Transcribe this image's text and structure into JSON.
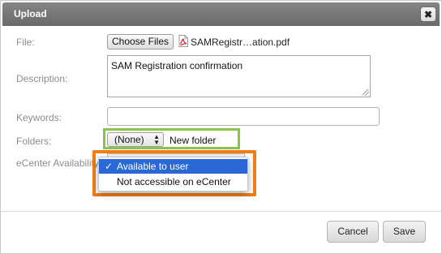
{
  "dialog": {
    "title": "Upload",
    "close_glyph": "✖"
  },
  "form": {
    "file_label": "File:",
    "choose_files_label": "Choose Files",
    "file_name": "SAMRegistr…ation.pdf",
    "description_label": "Description:",
    "description_value": "SAM Registration confirmation",
    "keywords_label": "Keywords:",
    "keywords_value": "",
    "folders_label": "Folders:",
    "folder_selected": "(None)",
    "new_folder_label": "New folder",
    "ecenter_label": "eCenter Availability:",
    "ecenter_options": [
      {
        "label": "Available to user",
        "selected": true
      },
      {
        "label": "Not accessible on eCenter",
        "selected": false
      }
    ],
    "check_glyph": "✓"
  },
  "footer": {
    "cancel_label": "Cancel",
    "save_label": "Save"
  },
  "icons": {
    "pdf": "pdf-file-icon",
    "close": "close-icon",
    "select_arrows": "updown-arrows-icon"
  },
  "colors": {
    "titlebar": "#6f6f6f",
    "highlight_green": "#8cc34a",
    "highlight_orange": "#f07d18",
    "selection_blue": "#2a68d8"
  }
}
